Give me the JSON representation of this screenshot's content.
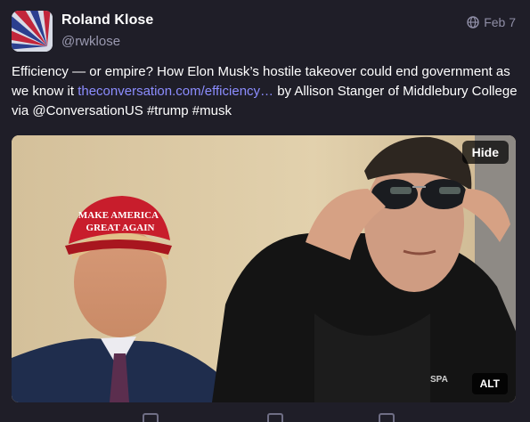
{
  "post": {
    "display_name": "Roland Klose",
    "handle": "@rwklose",
    "visibility_icon": "globe-icon",
    "date": "Feb 7",
    "text_before_link": "Efficiency — or empire? How Elon Musk’s hostile takeover could end government as we know it ",
    "link_text": "theconversation.com/efficiency…",
    "text_after_link": " by Allison Stanger of Middlebury College via @ConversationUS #trump #musk",
    "link_color": "#8c8dff"
  },
  "media": {
    "hide_label": "Hide",
    "alt_label": "ALT",
    "cap_text_line1": "MAKE AMERICA",
    "cap_text_line2": "GREAT AGAIN",
    "shirt_text": "SPA"
  },
  "colors": {
    "background": "#1f1e28",
    "muted_text": "#9a99b0"
  }
}
